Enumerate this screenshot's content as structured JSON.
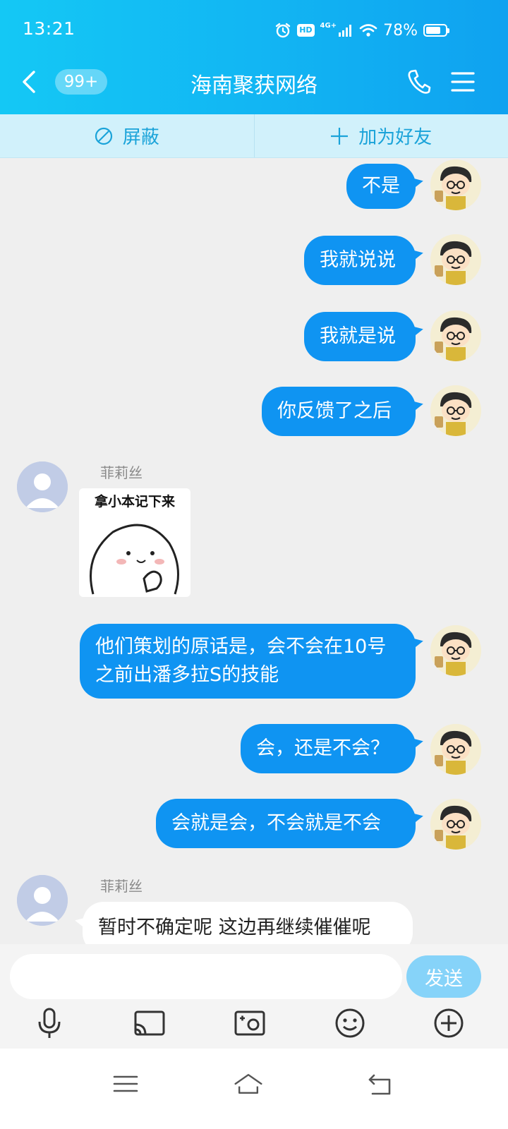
{
  "status_bar": {
    "time": "13:21",
    "hd": "HD",
    "network": "4G+",
    "battery": "78%",
    "battery_level": 0.78
  },
  "header": {
    "unread_count": "99+",
    "title": "海南聚获网络"
  },
  "actions": {
    "block": "屏蔽",
    "add_friend": "加为好友"
  },
  "messages": [
    {
      "side": "right",
      "text": "不是"
    },
    {
      "side": "right",
      "text": "我就说说"
    },
    {
      "side": "right",
      "text": "我就是说"
    },
    {
      "side": "right",
      "text": "你反馈了之后"
    },
    {
      "side": "left",
      "sender": "菲莉丝",
      "sticker_caption": "拿小本记下来"
    },
    {
      "side": "right",
      "text": "他们策划的原话是，会不会在10号之前出潘多拉S的技能"
    },
    {
      "side": "right",
      "text": "会，还是不会？"
    },
    {
      "side": "right",
      "text": "会就是会，不会就是不会"
    },
    {
      "side": "left",
      "sender": "菲莉丝",
      "text": "暂时不确定呢 这边再继续催催呢"
    }
  ],
  "input": {
    "value": "",
    "send_label": "发送"
  },
  "toolbar_icons": [
    "microphone-icon",
    "cast-icon",
    "photo-icon",
    "emoji-icon",
    "plus-icon"
  ],
  "nav_icons": [
    "menu-icon",
    "home-icon",
    "back-icon"
  ],
  "colors": {
    "header_start": "#14c8f5",
    "header_end": "#0fa2f0",
    "bubble_self": "#0f94f2",
    "action_bar": "#d1f1fb",
    "send_button": "#86d3f9"
  }
}
